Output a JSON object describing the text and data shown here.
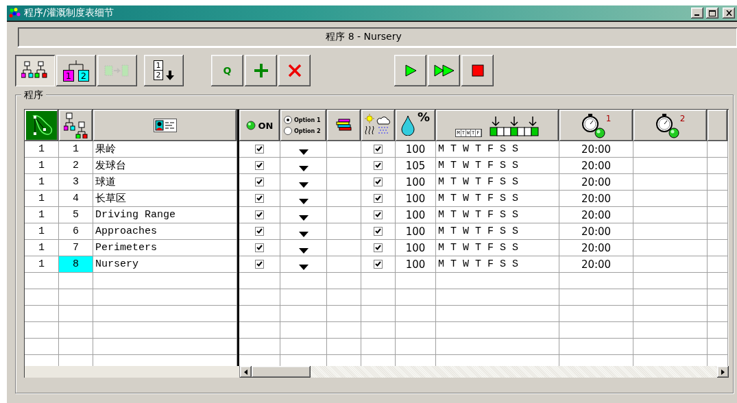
{
  "window": {
    "title": "程序/灌溉制度表细节"
  },
  "program_label": "程序 8 - Nursery",
  "toolbar_groups": [
    {
      "buttons": [
        {
          "kind": "tree-view",
          "pressed": true,
          "disabled": false
        },
        {
          "kind": "hierarchy",
          "labels": [
            "1",
            "2"
          ],
          "pressed": false,
          "disabled": false
        },
        {
          "kind": "move",
          "pressed": false,
          "disabled": true
        }
      ]
    },
    {
      "buttons": [
        {
          "kind": "sort",
          "labels": [
            "1",
            "2"
          ],
          "pressed": false,
          "disabled": false
        }
      ]
    },
    {
      "buttons": [
        {
          "kind": "text",
          "label": "Q",
          "pressed": false,
          "disabled": false
        },
        {
          "kind": "add",
          "pressed": false,
          "disabled": false
        },
        {
          "kind": "delete",
          "pressed": false,
          "disabled": false
        }
      ]
    },
    {
      "buttons": [
        {
          "kind": "play",
          "pressed": false,
          "disabled": false
        },
        {
          "kind": "fast-forward",
          "pressed": false,
          "disabled": false
        },
        {
          "kind": "stop",
          "pressed": false,
          "disabled": false
        }
      ]
    }
  ],
  "group_box": {
    "title": "程序"
  },
  "table": {
    "columns": [
      {
        "kind": "course-map"
      },
      {
        "kind": "hierarchy"
      },
      {
        "kind": "name-card"
      },
      {
        "kind": "on",
        "label": "ON"
      },
      {
        "kind": "option",
        "options": [
          {
            "label": "Option 1",
            "selected": true
          },
          {
            "label": "Option 2",
            "selected": false
          }
        ]
      },
      {
        "kind": "color-bars"
      },
      {
        "kind": "weather"
      },
      {
        "kind": "percent",
        "label": "%"
      },
      {
        "kind": "days",
        "labels": [
          "M",
          "T",
          "W",
          "T",
          "F"
        ]
      },
      {
        "kind": "timer",
        "label": "1"
      },
      {
        "kind": "timer",
        "label": "2"
      }
    ],
    "rows": [
      {
        "group": "1",
        "number": "1",
        "name": "果岭",
        "selected": false,
        "on": true,
        "weather": true,
        "percent": "100",
        "days": "M T W T F S S",
        "start_time": "20:00"
      },
      {
        "group": "1",
        "number": "2",
        "name": "发球台",
        "selected": false,
        "on": true,
        "weather": true,
        "percent": "105",
        "days": "M T W T F S S",
        "start_time": "20:00"
      },
      {
        "group": "1",
        "number": "3",
        "name": "球道",
        "selected": false,
        "on": true,
        "weather": true,
        "percent": "100",
        "days": "M T W T F S S",
        "start_time": "20:00"
      },
      {
        "group": "1",
        "number": "4",
        "name": "长草区",
        "selected": false,
        "on": true,
        "weather": true,
        "percent": "100",
        "days": "M T W T F S S",
        "start_time": "20:00"
      },
      {
        "group": "1",
        "number": "5",
        "name": "Driving Range",
        "selected": false,
        "on": true,
        "weather": true,
        "percent": "100",
        "days": "M T W T F S S",
        "start_time": "20:00"
      },
      {
        "group": "1",
        "number": "6",
        "name": "Approaches",
        "selected": false,
        "on": true,
        "weather": true,
        "percent": "100",
        "days": "M T W T F S S",
        "start_time": "20:00"
      },
      {
        "group": "1",
        "number": "7",
        "name": "Perimeters",
        "selected": false,
        "on": true,
        "weather": true,
        "percent": "100",
        "days": "M T W T F S S",
        "start_time": "20:00"
      },
      {
        "group": "1",
        "number": "8",
        "name": "Nursery",
        "selected": true,
        "on": true,
        "weather": true,
        "percent": "100",
        "days": "M T W T F S S",
        "start_time": "20:00"
      }
    ]
  }
}
